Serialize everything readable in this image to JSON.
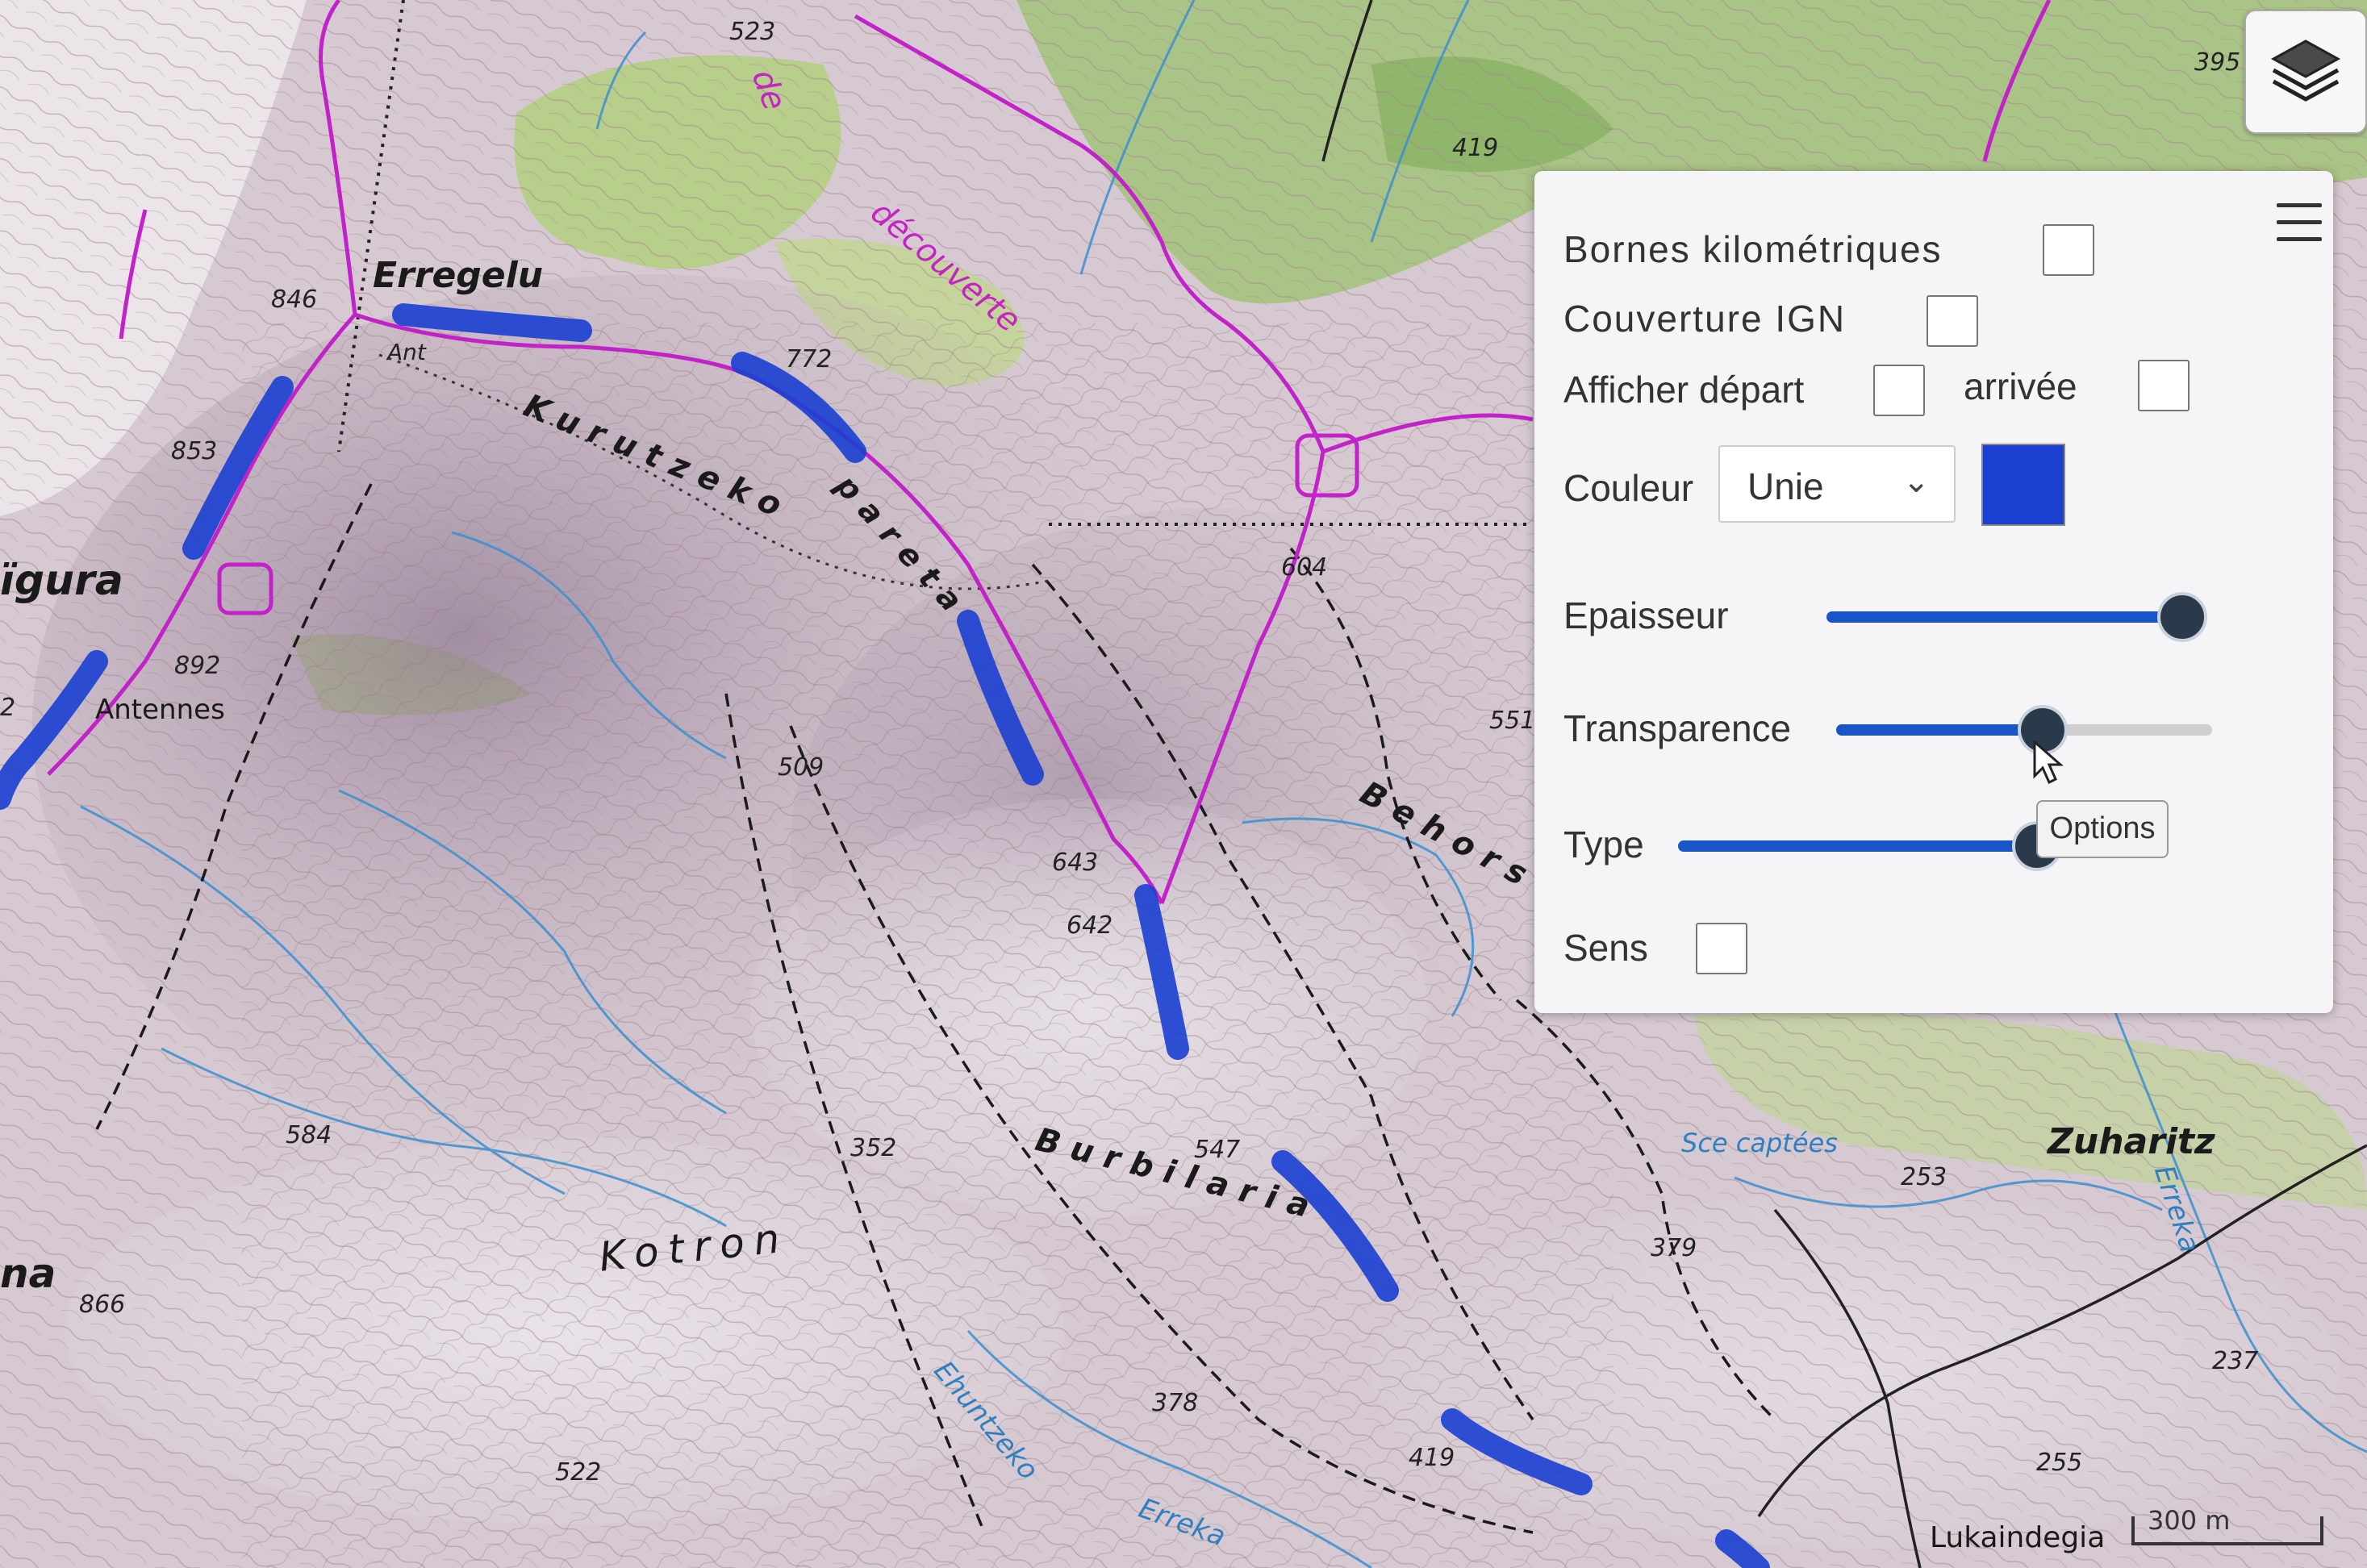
{
  "map": {
    "places": {
      "erregelu": "Erregelu",
      "ant": "Ant",
      "kurutzeko": "Kurutzeko",
      "pareta": "pareta",
      "higura": "ïgura",
      "antennes": "Antennes",
      "behors": "Behors",
      "burbilaria": "Burbilaria",
      "kotron": "Kotron",
      "na": "na",
      "zuharitz": "Zuharitz",
      "lukaindegia": "Lukaindegia",
      "sce_captees": "Sce captées",
      "erreka_right": "Erreka",
      "erreka_bottom": "Erreka",
      "ehuntzeko": "Ehuntzeko",
      "decouverte": "découverte",
      "de": "de"
    },
    "altitudes": {
      "a523": "523",
      "a395": "395",
      "a419_top": "419",
      "a846": "846",
      "a772": "772",
      "a853": "853",
      "a892": "892",
      "a604": "604",
      "a551": "551",
      "a509": "509",
      "a643": "643",
      "a642": "642",
      "a584": "584",
      "a352": "352",
      "a547": "547",
      "a379": "379",
      "a253": "253",
      "a866": "866",
      "a378": "378",
      "a522": "522",
      "a419_bot": "419",
      "a237": "237",
      "a255": "255",
      "a2": "2"
    },
    "scale_label": "300 m"
  },
  "layers_button": {
    "icon": "layers-icon"
  },
  "panel": {
    "menu_icon": "hamburger-icon",
    "bornes_label": "Bornes kilométriques",
    "couverture_label": "Couverture IGN",
    "afficher_label": "Afficher départ",
    "arrivee_label": "arrivée",
    "couleur_label": "Couleur",
    "couleur_value": "Unie",
    "couleur_swatch": "#1a3fd1",
    "epaisseur_label": "Epaisseur",
    "epaisseur_level": 0.93,
    "transparence_label": "Transparence",
    "transparence_level": 0.54,
    "type_label": "Type",
    "type_level": 0.93,
    "options_label": "Options",
    "sens_label": "Sens",
    "accent": "#1755c9"
  }
}
